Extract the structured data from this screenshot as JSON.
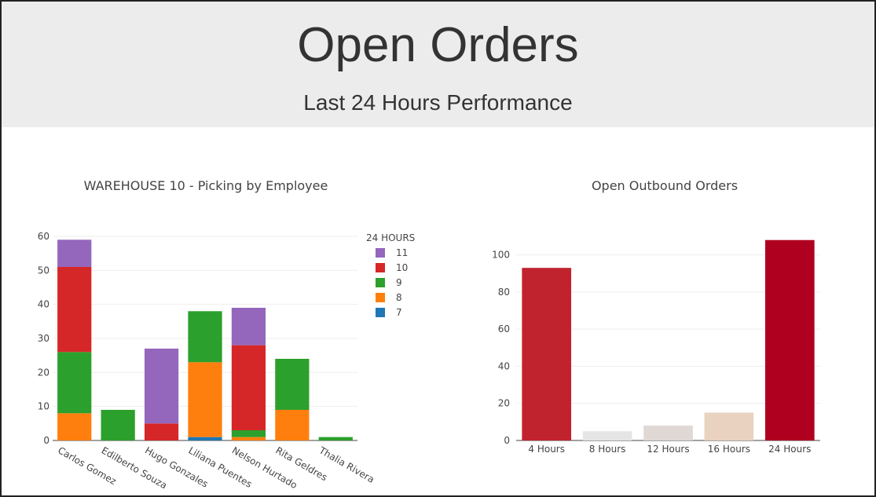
{
  "header": {
    "title": "Open Orders",
    "subtitle": "Last 24 Hours Performance"
  },
  "chart_data": [
    {
      "type": "bar",
      "stacked": true,
      "title": "WAREHOUSE 10 - Picking by Employee",
      "xlabel": "",
      "ylabel": "",
      "ylim": [
        0,
        60
      ],
      "yticks": [
        0,
        10,
        20,
        30,
        40,
        50,
        60
      ],
      "grid": true,
      "legend_title": "24 HOURS",
      "legend_position": "top-right",
      "categories": [
        "Carlos Gomez",
        "Edilberto Souza",
        "Hugo Gonzales",
        "Liliana Puentes",
        "Nelson Hurtado",
        "Rita Geldres",
        "Thalia Rivera"
      ],
      "series": [
        {
          "name": "7",
          "color": "#1f77b4",
          "values": [
            0,
            0,
            0,
            1,
            0,
            0,
            0
          ]
        },
        {
          "name": "8",
          "color": "#ff7f0e",
          "values": [
            8,
            0,
            0,
            22,
            1,
            9,
            0
          ]
        },
        {
          "name": "9",
          "color": "#2ca02c",
          "values": [
            18,
            9,
            0,
            15,
            2,
            15,
            1
          ]
        },
        {
          "name": "10",
          "color": "#d62728",
          "values": [
            25,
            0,
            5,
            0,
            25,
            0,
            0
          ]
        },
        {
          "name": "11",
          "color": "#9467bd",
          "values": [
            8,
            0,
            22,
            0,
            11,
            0,
            0
          ]
        }
      ]
    },
    {
      "type": "bar",
      "title": "Open Outbound Orders",
      "xlabel": "",
      "ylabel": "",
      "ylim": [
        0,
        110
      ],
      "yticks": [
        0,
        20,
        40,
        60,
        80,
        100
      ],
      "grid": true,
      "categories": [
        "4 Hours",
        "8 Hours",
        "12 Hours",
        "16 Hours",
        "24 Hours"
      ],
      "values": [
        93,
        5,
        8,
        15,
        108
      ],
      "colors": [
        "#c1232e",
        "#e5e5e5",
        "#e0d8d4",
        "#e9d2c0",
        "#b00020"
      ]
    }
  ]
}
